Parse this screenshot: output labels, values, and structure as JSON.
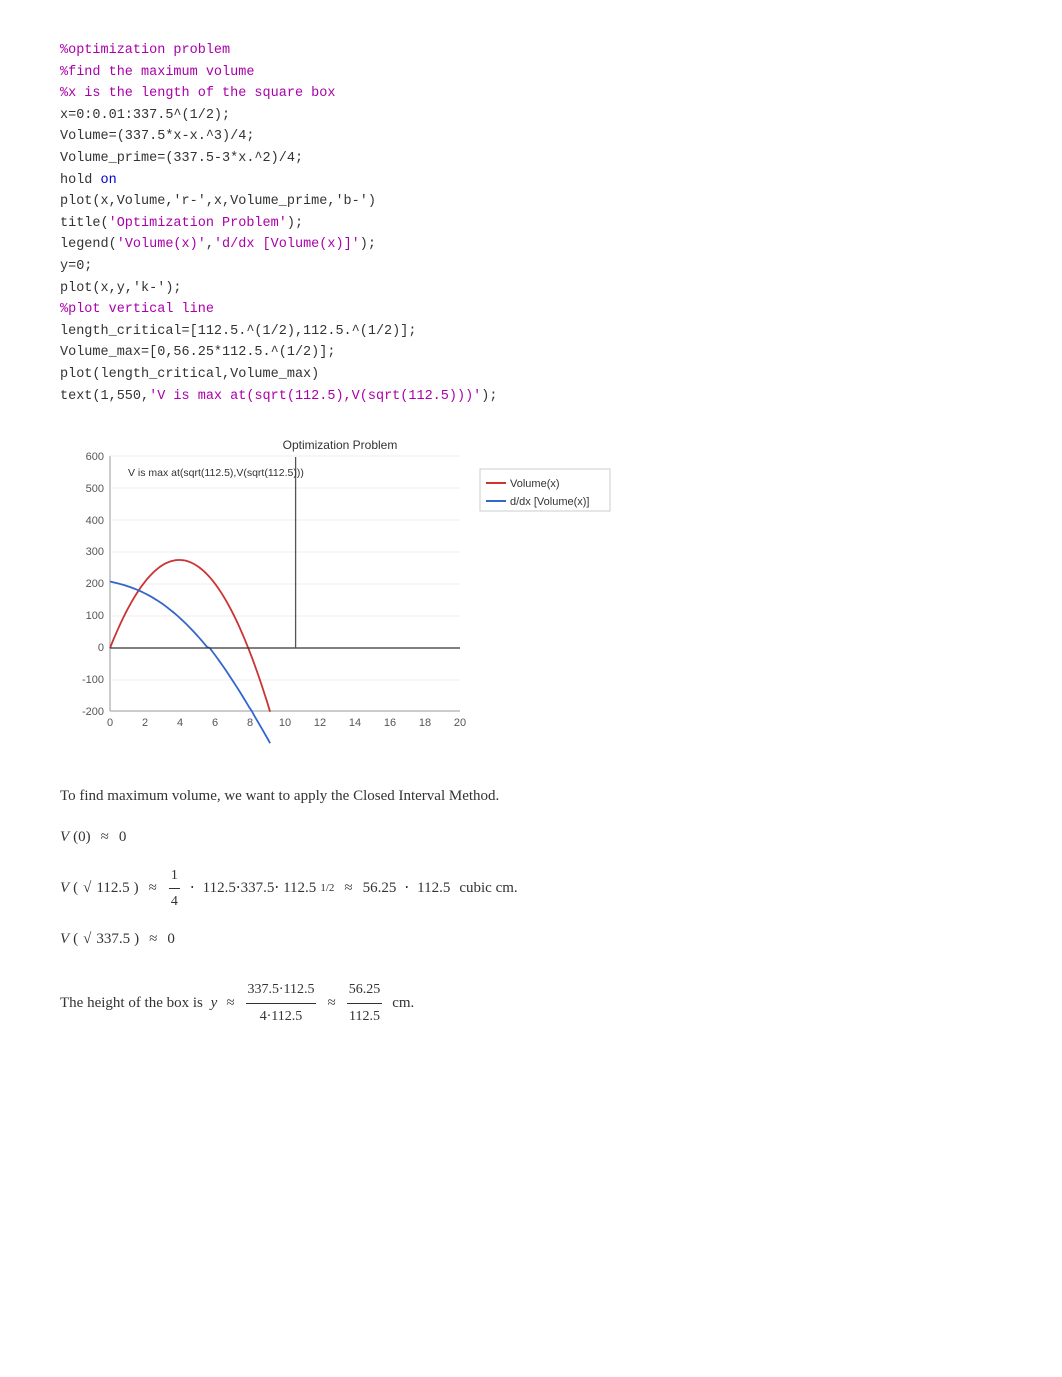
{
  "code": {
    "lines": [
      {
        "text": "%optimization problem",
        "type": "comment"
      },
      {
        "text": "%find the maximum volume",
        "type": "comment"
      },
      {
        "text": "%x is the length of the square box",
        "type": "comment"
      },
      {
        "text": "x=0:0.01:337.5^(1/2);",
        "type": "normal"
      },
      {
        "text": "Volume=(337.5*x-x.^3)/4;",
        "type": "normal"
      },
      {
        "text": "Volume_prime=(337.5-3*x.^2)/4;",
        "type": "normal"
      },
      {
        "text": "hold on",
        "type": "keyword"
      },
      {
        "text": "plot(x,Volume,'r-',x,Volume_prime,'b-')",
        "type": "normal"
      },
      {
        "text": "title('Optimization Problem');",
        "type": "string_line"
      },
      {
        "text": "legend('Volume(x)','d/dx [Volume(x)]');",
        "type": "string_line"
      },
      {
        "text": "y=0;",
        "type": "normal"
      },
      {
        "text": "plot(x,y,'k-');",
        "type": "normal"
      },
      {
        "text": "%plot vertical line",
        "type": "comment"
      },
      {
        "text": "length_critical=[112.5.^(1/2),112.5.^(1/2)];",
        "type": "normal"
      },
      {
        "text": "Volume_max=[0,56.25*112.5.^(1/2)];",
        "type": "normal"
      },
      {
        "text": "plot(length_critical,Volume_max)",
        "type": "normal"
      },
      {
        "text": "text(1,550,'V is max at(sqrt(112.5),V(sqrt(112.5))');",
        "type": "string_line"
      }
    ]
  },
  "chart": {
    "title": "Optimization Problem",
    "x_label": "",
    "y_axis": [
      600,
      500,
      400,
      300,
      200,
      100,
      0,
      -100,
      -200
    ],
    "x_axis": [
      0,
      2,
      4,
      6,
      8,
      10,
      12,
      14,
      16,
      18,
      20
    ],
    "legend": {
      "volume": "Volume(x)",
      "derivative": "d/dx [Volume(x)]"
    },
    "annotation": "V is max at(sqrt(112.5),V(sqrt(112.5)))"
  },
  "math": {
    "intro": "To find maximum volume, we want to apply the Closed Interval Method.",
    "lines": [
      "V(0) ≈ 0",
      "V(√112.5) ≈ (1/4) · 112.5·337.5·112.5^(1/2) ≈ 56.25 · 112.5 cubic cm.",
      "V(√337.5) ≈ 0"
    ],
    "height_label": "The height of the box is",
    "height_formula": "y = (337.5 · 112.5)/(4 · 112.5) = 56.25/112.5 cm."
  }
}
